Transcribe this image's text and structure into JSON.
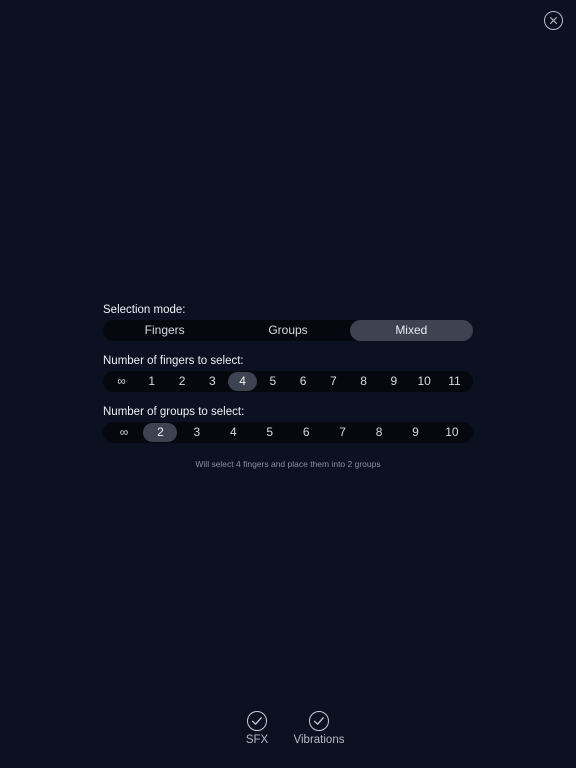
{
  "close": {
    "icon": "close-icon"
  },
  "selection_mode": {
    "label": "Selection mode:",
    "options": [
      "Fingers",
      "Groups",
      "Mixed"
    ],
    "selected": "Mixed"
  },
  "fingers": {
    "label": "Number of fingers to select:",
    "options": [
      "∞",
      "1",
      "2",
      "3",
      "4",
      "5",
      "6",
      "7",
      "8",
      "9",
      "10",
      "11"
    ],
    "selected": "4"
  },
  "groups": {
    "label": "Number of groups to select:",
    "options": [
      "∞",
      "2",
      "3",
      "4",
      "5",
      "6",
      "7",
      "8",
      "9",
      "10"
    ],
    "selected": "2"
  },
  "summary": "Will select 4 fingers and place them into 2 groups",
  "toggles": {
    "sfx": {
      "label": "SFX",
      "checked": true,
      "icon": "check-circle-icon"
    },
    "vibrations": {
      "label": "Vibrations",
      "checked": true,
      "icon": "check-circle-icon"
    }
  }
}
